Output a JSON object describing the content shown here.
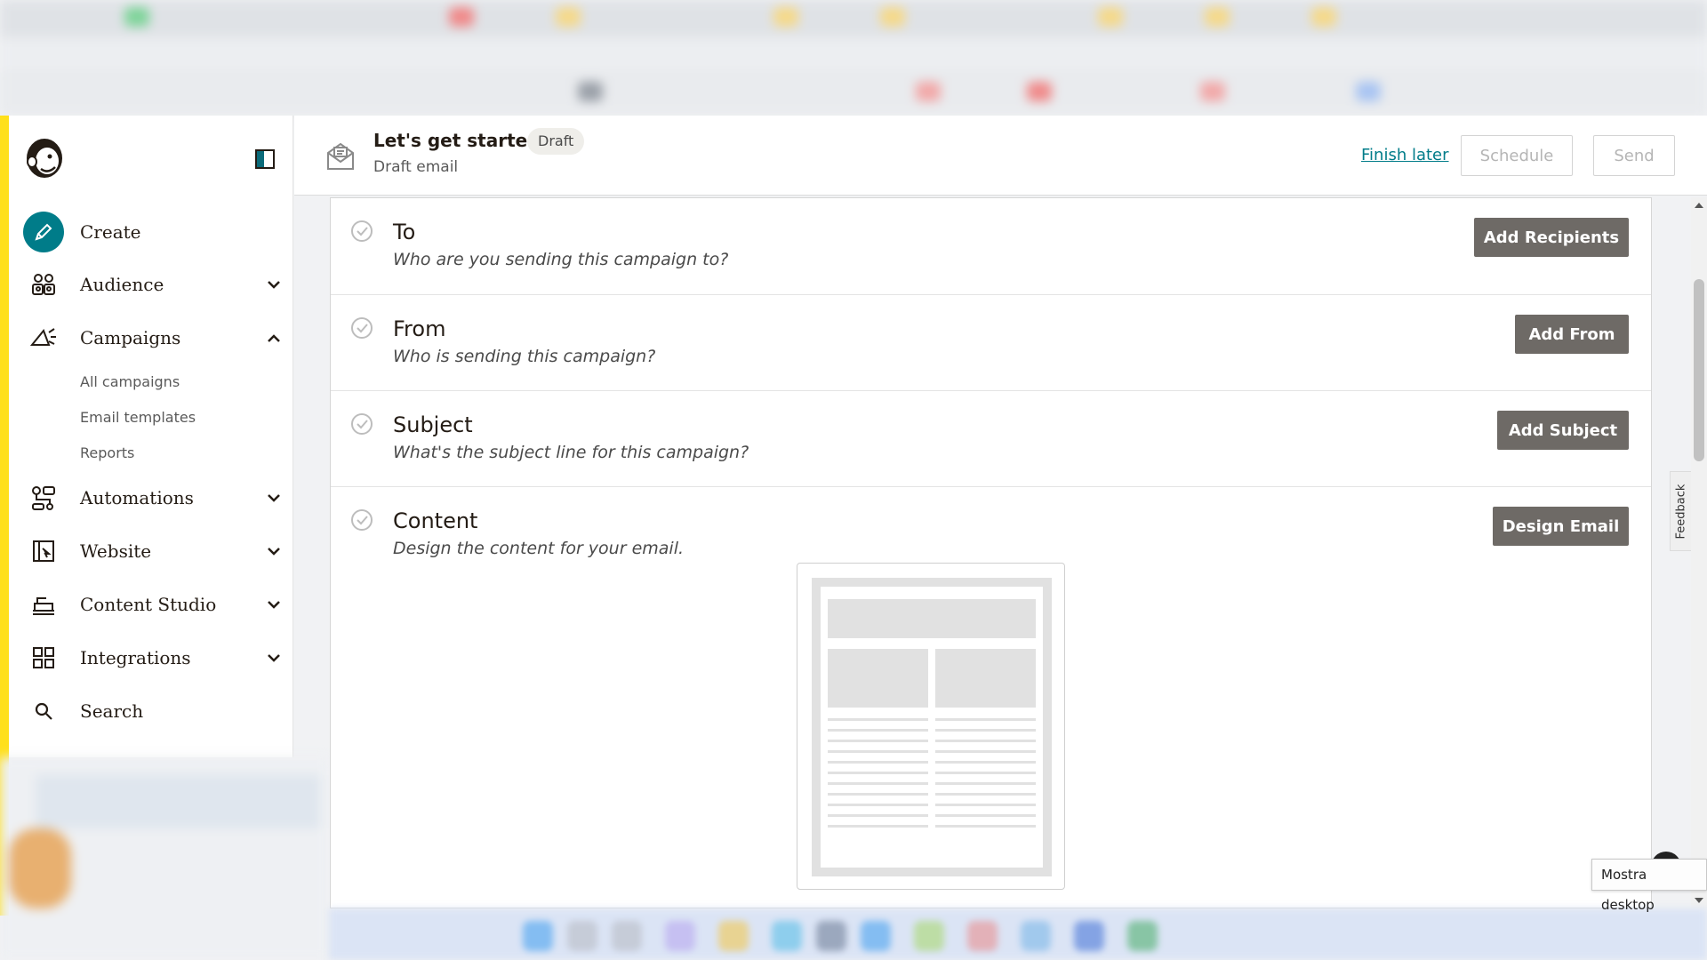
{
  "header": {
    "title": "Let's get started!",
    "badge": "Draft",
    "subtitle": "Draft email",
    "finish_later": "Finish later",
    "schedule": "Schedule",
    "send": "Send"
  },
  "sidebar": {
    "items": [
      {
        "label": "Create",
        "icon": "pencil-icon"
      },
      {
        "label": "Audience",
        "icon": "audience-icon"
      },
      {
        "label": "Campaigns",
        "icon": "megaphone-icon"
      },
      {
        "label": "Automations",
        "icon": "automations-icon"
      },
      {
        "label": "Website",
        "icon": "website-icon"
      },
      {
        "label": "Content Studio",
        "icon": "content-studio-icon"
      },
      {
        "label": "Integrations",
        "icon": "integrations-icon"
      },
      {
        "label": "Search",
        "icon": "search-icon"
      }
    ],
    "campaigns_sub": [
      "All campaigns",
      "Email templates",
      "Reports"
    ]
  },
  "steps": [
    {
      "title": "To",
      "desc": "Who are you sending this campaign to?",
      "button": "Add Recipients"
    },
    {
      "title": "From",
      "desc": "Who is sending this campaign?",
      "button": "Add From"
    },
    {
      "title": "Subject",
      "desc": "What's the subject line for this campaign?",
      "button": "Add Subject"
    },
    {
      "title": "Content",
      "desc": "Design the content for your email.",
      "button": "Design Email"
    }
  ],
  "feedback": "Feedback",
  "tooltip": "Mostra desktop",
  "colors": {
    "accent": "#ffe01b",
    "teal": "#007c89",
    "button_dark": "#6e6a66"
  }
}
